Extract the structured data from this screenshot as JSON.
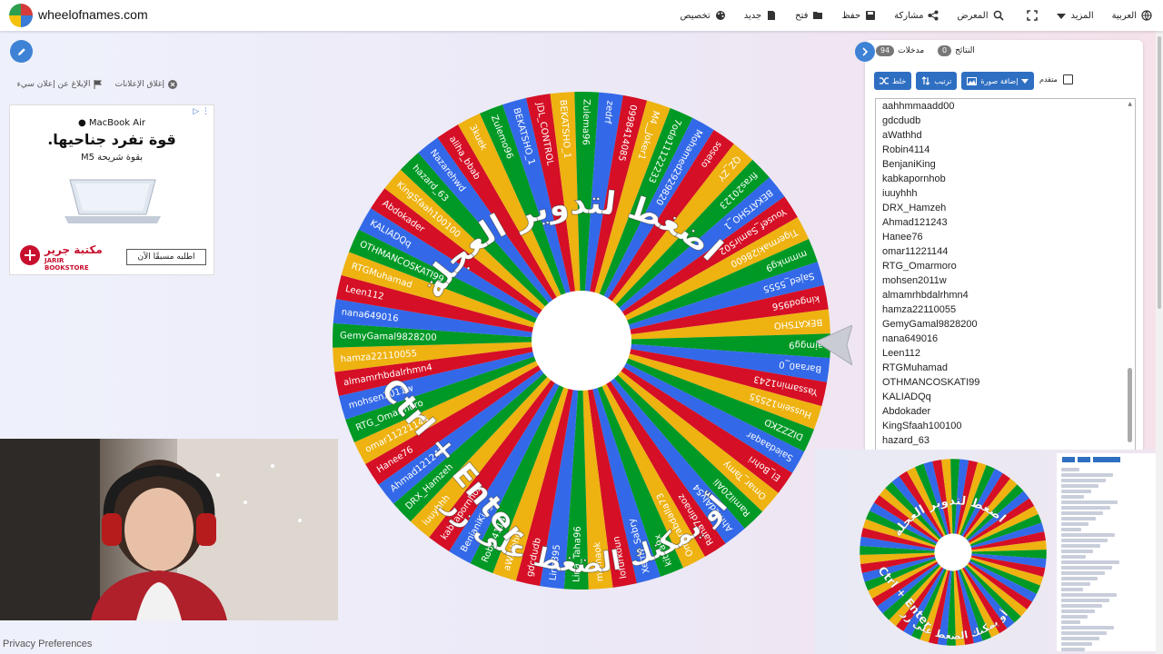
{
  "header": {
    "site_name": "wheelofnames.com",
    "menu": [
      {
        "label": "العربية",
        "icon": "globe-icon"
      },
      {
        "label": "المزيد",
        "icon": "chevron-down-icon"
      },
      {
        "label": "",
        "icon": "fullscreen-icon"
      },
      {
        "label": "المعرض",
        "icon": "search-icon"
      },
      {
        "label": "مشاركة",
        "icon": "share-icon"
      },
      {
        "label": "حفظ",
        "icon": "save-icon"
      },
      {
        "label": "فتح",
        "icon": "folder-icon"
      },
      {
        "label": "جديد",
        "icon": "file-icon"
      },
      {
        "label": "تخصيص",
        "icon": "palette-icon"
      }
    ]
  },
  "left": {
    "report_ad": "الإبلاغ عن إعلان سيء",
    "close_ad": "إغلاق الإعلانات",
    "ad": {
      "brand": "MacBook Air",
      "headline": "قوة تفرد جناحيها.",
      "subline": "بقوة شريحة M5",
      "store_ar": "مكتبة جرير",
      "store_en": "JARIR BOOKSTORE",
      "cta": "اطلبه مسبقًا الآن"
    },
    "privacy": "Privacy Preferences"
  },
  "wheel": {
    "center_text": "اضغط لتدوير العجلة",
    "or_text": "أو يمكنك الضغط على زر",
    "shortcut": "Ctrl + Enter",
    "colors": [
      "#3369e8",
      "#d50f25",
      "#eeb211",
      "#009925"
    ],
    "segment_labels": [
      "zedrf",
      "0998414085",
      "M4__Joker1",
      "7oda11122233",
      "Mohamed2929820",
      "soseto",
      "QZ_ZY",
      "firas20123",
      "BEKATSHO_1",
      "Yousef_Samir502",
      "Tigermaki28600",
      "mmmkg9",
      "Sajed_5555",
      "kingod956",
      "BEKATSHO",
      "aimgg9",
      "Baraa0_0",
      "Yassamin1243",
      "Hussein12555",
      "DIZZZKD",
      "Saiedaaqar",
      "El_Bohri",
      "Omar_Tamy",
      "Ramil20Ali",
      "AhmedAly54",
      "Rana7dinaoz",
      "Omarabdalla73",
      "kitya9x",
      "Xerny_Sabry",
      "lofurkoun",
      "mamaok",
      "Lina_Taha96",
      "Lino395",
      "gdcdudb",
      "aWathhd",
      "Robin4114",
      "BenjaniKing",
      "kabkapornhob",
      "iuuyhhh",
      "DRX_Hamzeh",
      "Ahmad121243",
      "Hanee76",
      "omar11221144",
      "RTG_Omarmoro",
      "mohsen2011w",
      "almamrhbdalrhmn4",
      "hamza22110055",
      "GemyGamal9828200",
      "nana649016",
      "Leen112",
      "RTGMuhamad",
      "OTHMANCOSKATI99",
      "KALIADQq",
      "Abdokader",
      "KingSfaah100100",
      "hazard_63",
      "Nazarehwd",
      "aliha_bbab",
      "3kuek",
      "Zulemo96",
      "BEKATSHO_1",
      "JDL_CONTROL",
      "BEKATSHO_1",
      "Zulema96"
    ]
  },
  "panel": {
    "tab_entries": "مدخلات",
    "entries_count": "94",
    "tab_results": "النتائج",
    "results_count": "0",
    "btn_shuffle": "خلط",
    "btn_sort": "ترتيب",
    "btn_add_image": "إضافة صورة",
    "advanced": "متقدم",
    "entries": [
      "aahhmmaadd00",
      "gdcdudb",
      "aWathhd",
      "Robin4114",
      "BenjaniKing",
      "kabkapornhob",
      "iuuyhhh",
      "DRX_Hamzeh",
      "Ahmad121243",
      "Hanee76",
      "omar11221144",
      "RTG_Omarmoro",
      "mohsen2011w",
      "almamrhbdalrhmn4",
      "hamza22110055",
      "GemyGamal9828200",
      "nana649016",
      "Leen112",
      "RTGMuhamad",
      "OTHMANCOSKATI99",
      "KALIADQq",
      "Abdokader",
      "KingSfaah100100",
      "hazard_63"
    ]
  }
}
